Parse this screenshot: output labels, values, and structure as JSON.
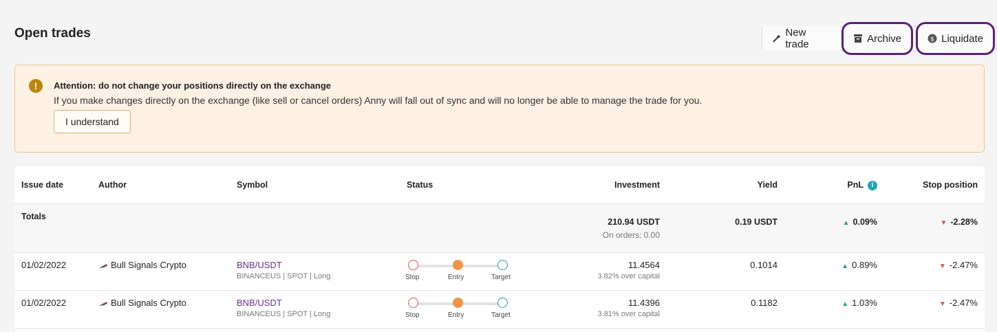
{
  "header": {
    "title": "Open trades",
    "new_trade": "New trade",
    "archive": "Archive",
    "liquidate": "Liquidate"
  },
  "alert": {
    "icon": "!",
    "title": "Attention: do not change your positions directly on the exchange",
    "text": "If you make changes directly on the exchange (like sell or cancel orders) Anny will fall out of sync and will no longer be able to manage the trade for you.",
    "button": "I understand"
  },
  "table": {
    "columns": [
      "Issue date",
      "Author",
      "Symbol",
      "Status",
      "Investment",
      "Yield",
      "PnL",
      "Stop position"
    ],
    "totals": {
      "label": "Totals",
      "investment": "210.94 USDT",
      "on_orders": "On orders: 0.00",
      "yield": "0.19 USDT",
      "pnl": "0.09%",
      "stop": "-2.28%"
    },
    "rows": [
      {
        "date": "01/02/2022",
        "author": "Bull Signals Crypto",
        "symbol": "BNB/USDT",
        "meta": "BINANCEUS | SPOT | Long",
        "status": {
          "stop": "Stop",
          "entry": "Entry",
          "target": "Target"
        },
        "investment": "11.4564",
        "over_capital": "3.82% over capital",
        "yield": "0.1014",
        "pnl": "0.89%",
        "stop": "-2.47%"
      },
      {
        "date": "01/02/2022",
        "author": "Bull Signals Crypto",
        "symbol": "BNB/USDT",
        "meta": "BINANCEUS | SPOT | Long",
        "status": {
          "stop": "Stop",
          "entry": "Entry",
          "target": "Target"
        },
        "investment": "11.4396",
        "over_capital": "3.81% over capital",
        "yield": "0.1182",
        "pnl": "1.03%",
        "stop": "-2.47%"
      }
    ]
  },
  "colors": {
    "accent": "#6b2f8a",
    "highlight_ring": "#5a1f7a",
    "alert_bg": "#fdf1e4",
    "positive": "#2a9d8f",
    "negative": "#d9534f",
    "entry_dot": "#f0954a"
  },
  "icons": {
    "new_trade": "magic-wand-icon",
    "archive": "archive-box-icon",
    "liquidate": "dollar-coin-icon",
    "alert": "exclamation-circle-icon",
    "pnl_info": "info-icon",
    "author": "bull-flag-icon",
    "positive": "triangle-up-icon",
    "negative": "triangle-down-icon"
  }
}
